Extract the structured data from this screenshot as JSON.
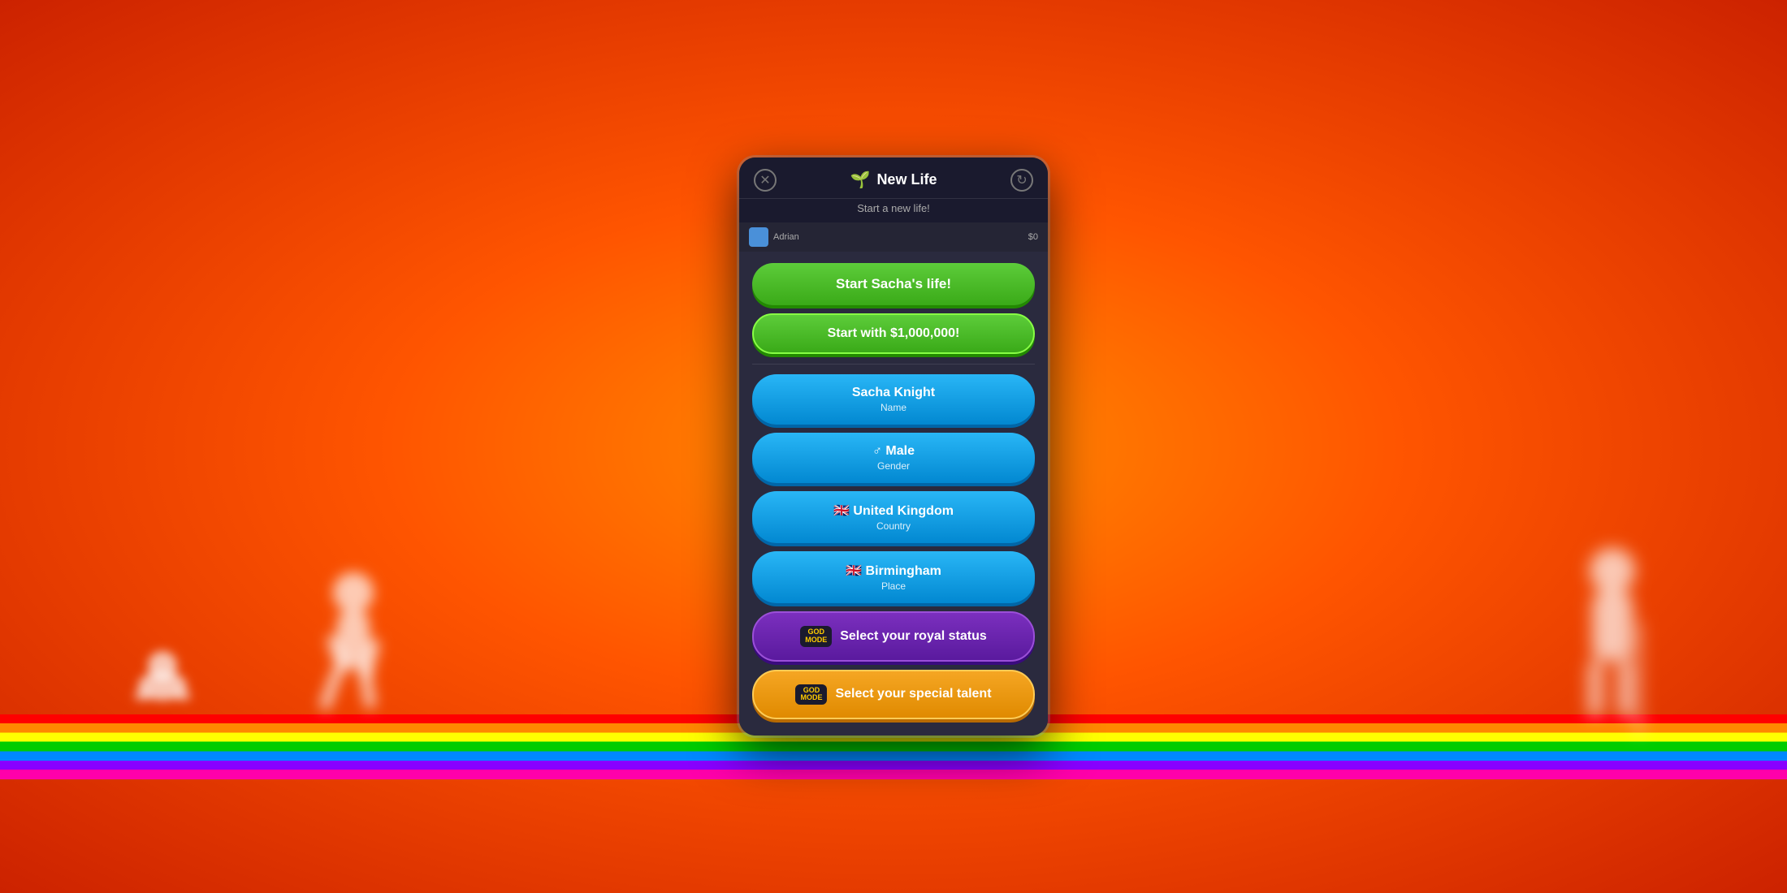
{
  "background": {
    "color_start": "#ff8c00",
    "color_end": "#cc2200"
  },
  "modal": {
    "title": "New Life",
    "title_emoji": "🌱",
    "subtitle": "Start a new life!",
    "close_icon": "✕",
    "refresh_icon": "↻",
    "top_bar": {
      "username": "Adrian",
      "money": "$0"
    },
    "buttons": {
      "start_life": "Start Sacha's life!",
      "million": "Start with $1,000,000!",
      "name": {
        "main": "Sacha Knight",
        "sub": "Name"
      },
      "gender": {
        "main": "♂ Male",
        "sub": "Gender"
      },
      "country": {
        "main": "🇬🇧 United Kingdom",
        "sub": "Country"
      },
      "place": {
        "main": "🇬🇧 Birmingham",
        "sub": "Place"
      },
      "royal": {
        "badge_line1": "GOD",
        "badge_line2": "MODE",
        "label": "Select your royal status"
      },
      "talent": {
        "badge_line1": "GOD",
        "badge_line2": "MODE",
        "label": "Select your special talent"
      }
    }
  }
}
